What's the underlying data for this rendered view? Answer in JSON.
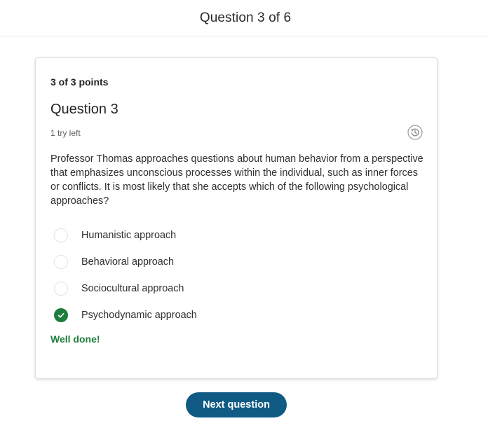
{
  "header": {
    "title": "Question 3 of 6"
  },
  "question": {
    "points": "3 of 3 points",
    "title": "Question 3",
    "tries": "1 try left",
    "history_icon": "history-icon",
    "prompt": "Professor Thomas approaches questions about human behavior from a perspective that emphasizes unconscious processes within the individual, such as inner forces or conflicts. It is most likely that she accepts which of the following psychological approaches?",
    "options": [
      {
        "label": "Humanistic approach",
        "selected": false
      },
      {
        "label": "Behavioral approach",
        "selected": false
      },
      {
        "label": "Sociocultural approach",
        "selected": false
      },
      {
        "label": "Psychodynamic approach",
        "selected": true,
        "correct": true
      }
    ],
    "feedback": "Well done!"
  },
  "actions": {
    "next_label": "Next question"
  },
  "colors": {
    "accent": "#0f5b84",
    "success": "#1e7d3c"
  }
}
